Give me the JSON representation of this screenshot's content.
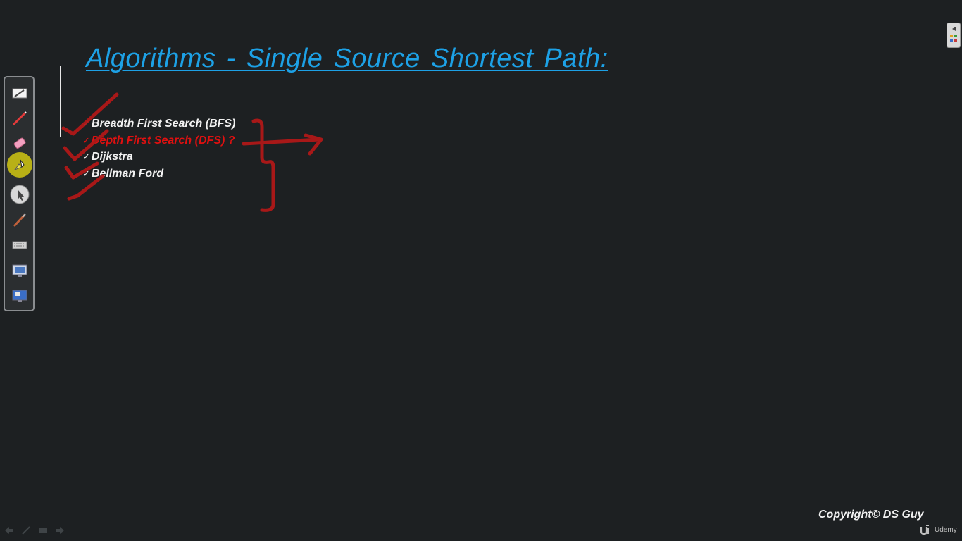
{
  "slide": {
    "title": "Algorithms - Single Source Shortest Path:",
    "items": [
      {
        "check": "✓",
        "label": "Breadth First Search (BFS)"
      },
      {
        "check": "✓",
        "label": "Depth First Search (DFS) ?"
      },
      {
        "check": "✓",
        "label": "Dijkstra"
      },
      {
        "check": "✓",
        "label": "Bellman Ford"
      }
    ]
  },
  "footer": {
    "copyright": "Copyright© DS Guy",
    "brand": "Udemy"
  },
  "toolbar": {
    "tools": [
      "whiteboard-icon",
      "pen-icon",
      "eraser-icon",
      "highlighter-icon",
      "pointer-icon",
      "brush-icon",
      "keyboard-icon",
      "screen-capture-icon",
      "desktop-icon"
    ]
  },
  "colors": {
    "background": "#1d2022",
    "title": "#1da1e6",
    "text": "#f2f2f2",
    "highlight": "#e01010",
    "ink": "#b01818"
  }
}
